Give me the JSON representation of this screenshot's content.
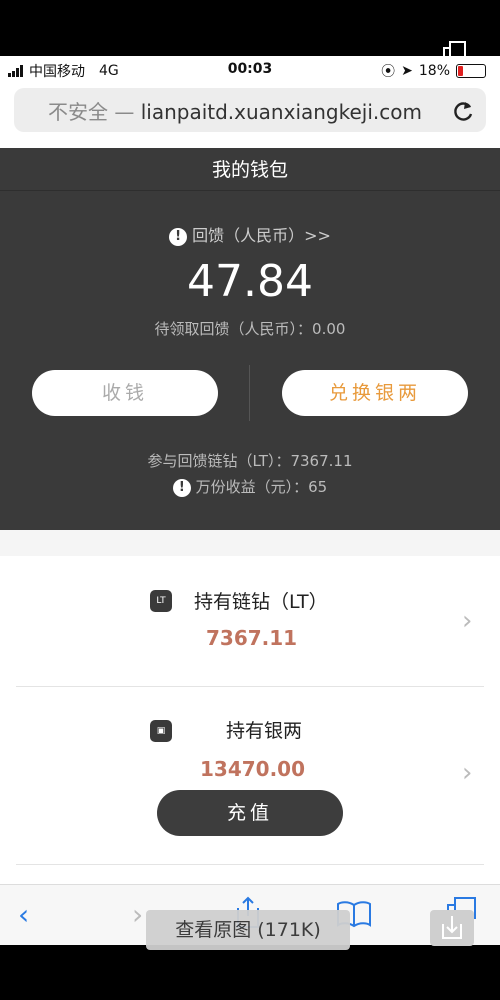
{
  "status": {
    "carrier": "中国移动",
    "network": "4G",
    "time": "00:03",
    "battery": "18%",
    "battery_level": 0.18
  },
  "url": {
    "insecure": "不安全 —",
    "domain": "lianpaitd.xuanxiangkeji.com"
  },
  "wallet": {
    "title": "我的钱包",
    "feedback_label": "回馈（人民币）>>",
    "feedback_value": "47.84",
    "pending_line": "待领取回馈（人民币）：0.00",
    "collect_label": "收钱",
    "exchange_label": "兑换银两",
    "lt_line": "参与回馈链钻（LT）：7367.11",
    "yield_line": "万份收益（元）：65"
  },
  "holdings": [
    {
      "title": "持有链钻（LT）",
      "value": "7367.11",
      "icon": "lt-icon",
      "icon_text": "LT"
    },
    {
      "title": "持有银两",
      "value": "13470.00",
      "icon": "silver-icon"
    }
  ],
  "recharge_label": "充值",
  "overlay": {
    "view_original": "查看原图 (171K)"
  },
  "colors": {
    "panel": "#3a3a3a",
    "accent_orange": "#e89a3c",
    "value_red": "#c0735e",
    "ios_blue": "#2a7ae2"
  }
}
